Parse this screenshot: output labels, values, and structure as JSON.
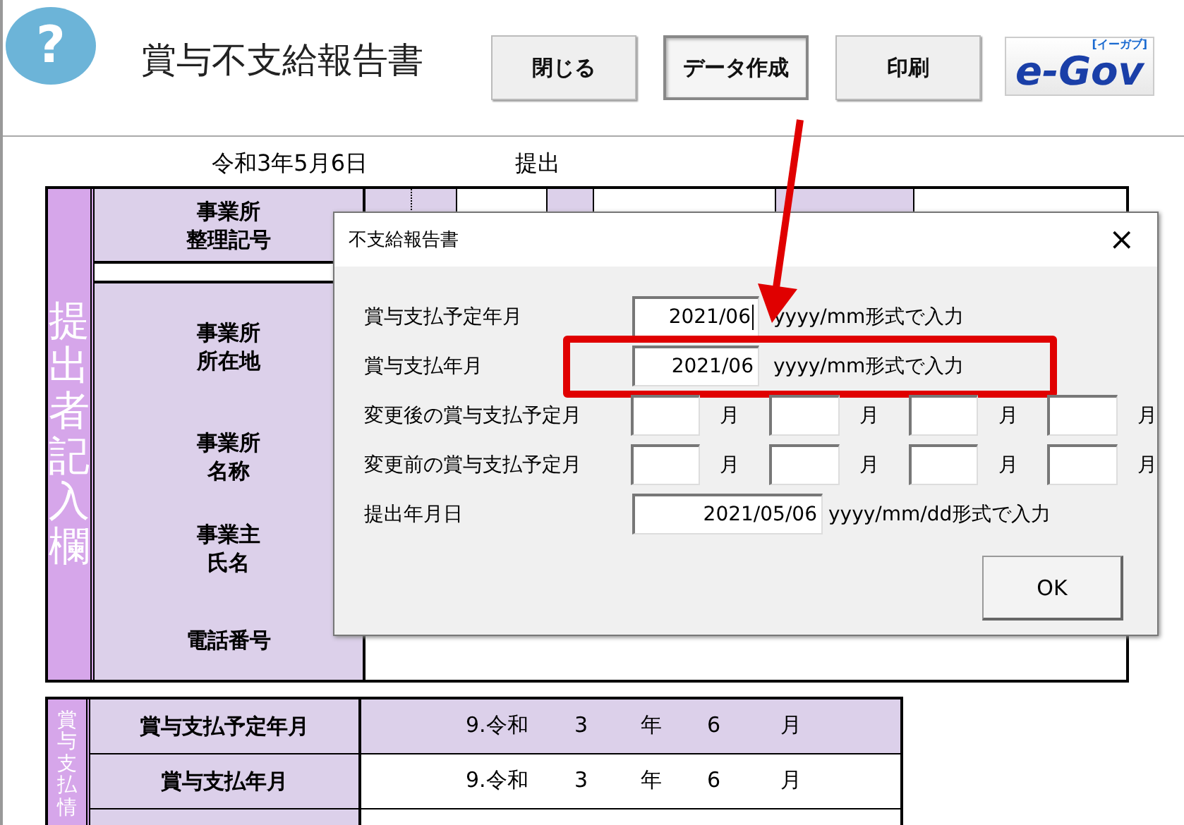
{
  "header": {
    "help_button": "?",
    "title": "賞与不支給報告書",
    "buttons": [
      {
        "label": "閉じる",
        "selected": false
      },
      {
        "label": "データ作成",
        "selected": true
      },
      {
        "label": "印刷",
        "selected": false
      }
    ],
    "logo": {
      "text": "e-Gov",
      "ruby": "[イーガブ]"
    }
  },
  "sheet": {
    "date": "令和3年5月6日",
    "submit_label": "提出",
    "submitter": {
      "side_label": "提出者記入欄",
      "code_label": [
        "事業所",
        "整理記号"
      ],
      "rows": [
        {
          "label": [
            "事業所",
            "所在地"
          ]
        },
        {
          "label": [
            "事業所",
            "名称"
          ]
        },
        {
          "label": [
            "事業主",
            "氏名"
          ]
        },
        {
          "label": [
            "電話番号"
          ]
        }
      ]
    },
    "bonus": {
      "side_label": "賞与支払情",
      "rows": [
        {
          "label": "賞与支払予定年月",
          "era": "9.令和",
          "year": "3",
          "year_unit": "年",
          "month": "6",
          "month_unit": "月",
          "shaded": true
        },
        {
          "label": "賞与支払年月",
          "era": "9.令和",
          "year": "3",
          "year_unit": "年",
          "month": "6",
          "month_unit": "月",
          "shaded": false
        }
      ]
    }
  },
  "dialog": {
    "title": "不支給報告書",
    "close": "×",
    "rows": [
      {
        "kind": "single",
        "label": "賞与支払予定年月",
        "value": "2021/06",
        "hint": "yyyy/mm形式で入力",
        "focused": true,
        "highlighted": false
      },
      {
        "kind": "single",
        "label": "賞与支払年月",
        "value": "2021/06",
        "hint": "yyyy/mm形式で入力",
        "focused": false,
        "highlighted": true
      },
      {
        "kind": "months",
        "label": "変更後の賞与支払予定月",
        "months": [
          {
            "unit": "月"
          },
          {
            "unit": "月"
          },
          {
            "unit": "月"
          },
          {
            "unit": "月"
          }
        ]
      },
      {
        "kind": "months",
        "label": "変更前の賞与支払予定月",
        "months": [
          {
            "unit": "月"
          },
          {
            "unit": "月"
          },
          {
            "unit": "月"
          },
          {
            "unit": "月"
          }
        ]
      },
      {
        "kind": "date",
        "label": "提出年月日",
        "value": "2021/05/06",
        "hint": "yyyy/mm/dd形式で入力",
        "focused": false,
        "highlighted": false
      }
    ],
    "ok": "OK"
  }
}
